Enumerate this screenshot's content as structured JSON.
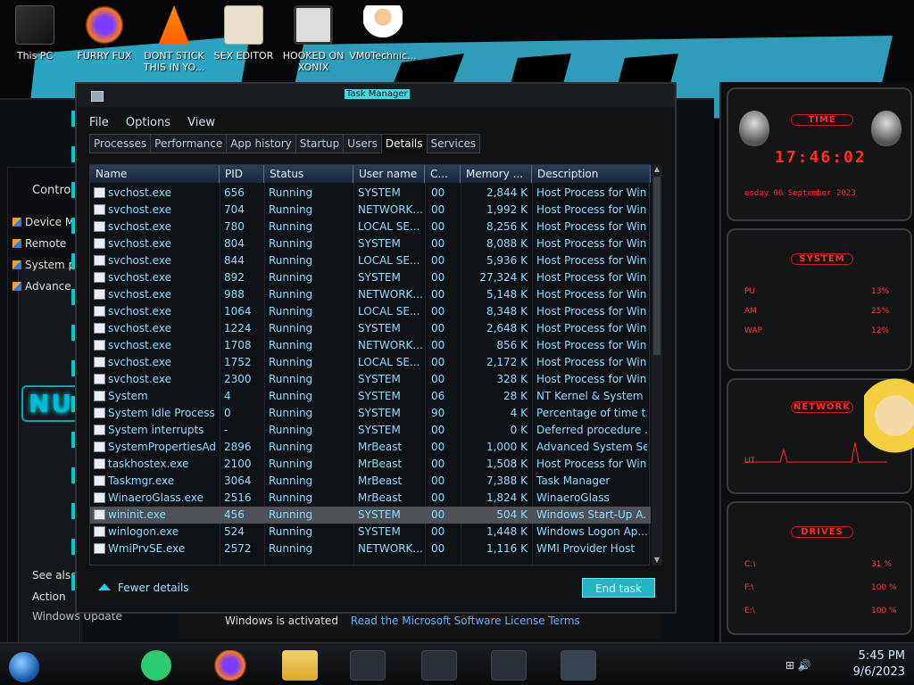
{
  "desktop": {
    "icons": [
      {
        "label": "This PC"
      },
      {
        "label": "FURRY FUX"
      },
      {
        "label": "DONT STICK THIS IN YO..."
      },
      {
        "label": "SEX EDITOR"
      },
      {
        "label": "HOOKED ON XONIX"
      },
      {
        "label": "VM0Technic..."
      }
    ]
  },
  "background_window": {
    "items": [
      "Control",
      "Device M",
      "Remote",
      "System p",
      "Advance"
    ],
    "see_also": "See also",
    "action": "Action",
    "windows_update": "Windows Update",
    "logo": "NU"
  },
  "activation": {
    "status": "Windows is activated",
    "link": "Read the Microsoft Software License Terms"
  },
  "task_manager": {
    "title": "Task Manager",
    "menu": [
      "File",
      "Options",
      "View"
    ],
    "tabs": [
      "Processes",
      "Performance",
      "App history",
      "Startup",
      "Users",
      "Details",
      "Services"
    ],
    "active_tab": "Details",
    "columns": [
      "Name",
      "PID",
      "Status",
      "User name",
      "C...",
      "Memory ...",
      "Description"
    ],
    "rows": [
      [
        "svchost.exe",
        "656",
        "Running",
        "SYSTEM",
        "00",
        "2,844 K",
        "Host Process for Win..."
      ],
      [
        "svchost.exe",
        "704",
        "Running",
        "NETWORK...",
        "00",
        "1,992 K",
        "Host Process for Win..."
      ],
      [
        "svchost.exe",
        "780",
        "Running",
        "LOCAL SE...",
        "00",
        "8,256 K",
        "Host Process for Win..."
      ],
      [
        "svchost.exe",
        "804",
        "Running",
        "SYSTEM",
        "00",
        "8,088 K",
        "Host Process for Win..."
      ],
      [
        "svchost.exe",
        "844",
        "Running",
        "LOCAL SE...",
        "00",
        "5,936 K",
        "Host Process for Win..."
      ],
      [
        "svchost.exe",
        "892",
        "Running",
        "SYSTEM",
        "00",
        "27,324 K",
        "Host Process for Win..."
      ],
      [
        "svchost.exe",
        "988",
        "Running",
        "NETWORK...",
        "00",
        "5,148 K",
        "Host Process for Win..."
      ],
      [
        "svchost.exe",
        "1064",
        "Running",
        "LOCAL SE...",
        "00",
        "8,348 K",
        "Host Process for Win..."
      ],
      [
        "svchost.exe",
        "1224",
        "Running",
        "SYSTEM",
        "00",
        "2,648 K",
        "Host Process for Win..."
      ],
      [
        "svchost.exe",
        "1708",
        "Running",
        "NETWORK...",
        "00",
        "856 K",
        "Host Process for Win..."
      ],
      [
        "svchost.exe",
        "1752",
        "Running",
        "LOCAL SE...",
        "00",
        "2,172 K",
        "Host Process for Win..."
      ],
      [
        "svchost.exe",
        "2300",
        "Running",
        "SYSTEM",
        "00",
        "328 K",
        "Host Process for Win..."
      ],
      [
        "System",
        "4",
        "Running",
        "SYSTEM",
        "06",
        "28 K",
        "NT Kernel & System"
      ],
      [
        "System Idle Process",
        "0",
        "Running",
        "SYSTEM",
        "90",
        "4 K",
        "Percentage of time t..."
      ],
      [
        "System interrupts",
        "-",
        "Running",
        "SYSTEM",
        "00",
        "0 K",
        "Deferred procedure ..."
      ],
      [
        "SystemPropertiesAd...",
        "2896",
        "Running",
        "MrBeast",
        "00",
        "1,000 K",
        "Advanced System Se..."
      ],
      [
        "taskhostex.exe",
        "2100",
        "Running",
        "MrBeast",
        "00",
        "1,508 K",
        "Host Process for Win..."
      ],
      [
        "Taskmgr.exe",
        "3064",
        "Running",
        "MrBeast",
        "00",
        "7,388 K",
        "Task Manager"
      ],
      [
        "WinaeroGlass.exe",
        "2516",
        "Running",
        "MrBeast",
        "00",
        "1,824 K",
        "WinaeroGlass"
      ],
      [
        "wininit.exe",
        "456",
        "Running",
        "SYSTEM",
        "00",
        "504 K",
        "Windows Start-Up A..."
      ],
      [
        "winlogon.exe",
        "524",
        "Running",
        "SYSTEM",
        "00",
        "1,448 K",
        "Windows Logon Ap..."
      ],
      [
        "WmiPrvSE.exe",
        "2572",
        "Running",
        "NETWORK...",
        "00",
        "1,116 K",
        "WMI Provider Host"
      ]
    ],
    "selected_row_index": 19,
    "fewer_details": "Fewer details",
    "end_task": "End task"
  },
  "gadgets": {
    "time_title": "TIME",
    "time": "17:46:02",
    "date": "esday 06 September 2023",
    "system_title": "SYSTEM",
    "cpu_label": "PU",
    "cpu_value": "13%",
    "ram_label": "AM",
    "ram_value": "25%",
    "swap_label": "WAP",
    "swap_value": "12%",
    "network_title": "NETWORK",
    "network_label": "UT",
    "drives_title": "DRIVES",
    "drives": [
      {
        "label": "C:\\",
        "value": "31 %"
      },
      {
        "label": "F:\\",
        "value": "100 %"
      },
      {
        "label": "E:\\",
        "value": "100 %"
      }
    ]
  },
  "taskbar": {
    "time": "5:45 PM",
    "date": "9/6/2023"
  },
  "colors": {
    "accent": "#1ad0e8",
    "list_text": "#8fdcff",
    "gadget_red": "#ff2a2a"
  }
}
